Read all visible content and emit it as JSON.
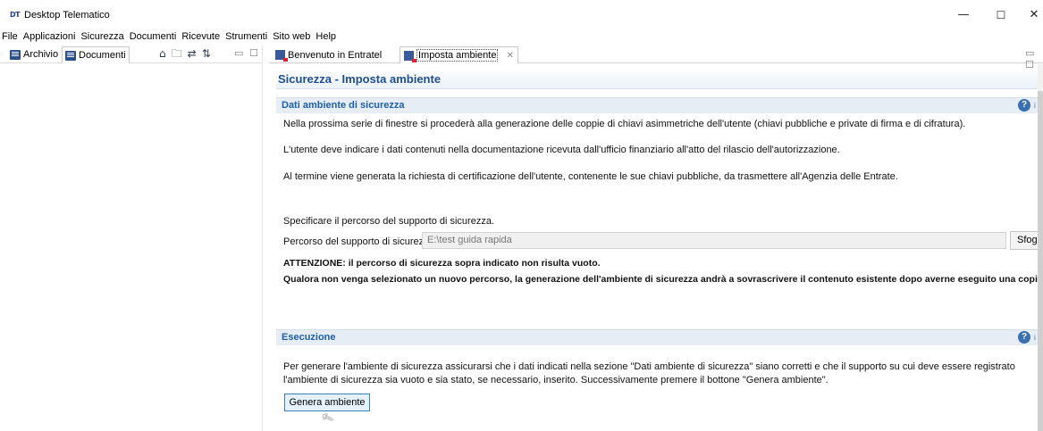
{
  "window": {
    "logo_text": "DT",
    "title": "Desktop Telematico",
    "min_glyph": "—",
    "max_glyph": "☐",
    "close_glyph": "✕"
  },
  "menu": {
    "items": [
      "File",
      "Applicazioni",
      "Sicurezza",
      "Documenti",
      "Ricevute",
      "Strumenti",
      "Sito web",
      "Help"
    ]
  },
  "left_pane": {
    "tabs": [
      {
        "label": "Archivio",
        "icon": "archive-icon"
      },
      {
        "label": "Documenti",
        "icon": "documents-icon"
      }
    ],
    "tools": [
      {
        "name": "home-icon",
        "glyph": "⌂"
      },
      {
        "name": "folder-icon",
        "glyph": "🗀"
      },
      {
        "name": "sync-icon",
        "glyph": "⇄"
      },
      {
        "name": "sort-icon",
        "glyph": "⇅"
      }
    ],
    "minimize_glyph": "▭",
    "maximize_glyph": "☐"
  },
  "right_pane": {
    "tabs": [
      {
        "label": "Benvenuto in Entratel",
        "icon": "entratel-icon"
      },
      {
        "label": "Imposta ambiente",
        "icon": "entratel-icon",
        "active": true
      }
    ],
    "tab_close_glyph": "✕",
    "ctrl_glyph": "▭ ☐"
  },
  "form": {
    "title": "Sicurezza - Imposta ambiente",
    "section1": {
      "title": "Dati ambiente di sicurezza",
      "help_glyph": "?",
      "help_suffix": "i",
      "p1": "Nella  prossima serie di finestre  si procederà  alla generazione delle coppie di chiavi asimmetriche dell'utente (chiavi pubbliche e private di firma e di cifratura).",
      "p2": "L'utente deve indicare i dati contenuti nella documentazione ricevuta dall'ufficio finanziario all'atto del rilascio dell'autorizzazione.",
      "p3": "Al termine viene generata la richiesta di certificazione dell'utente, contenente le sue chiavi pubbliche, da trasmettere all'Agenzia delle Entrate.",
      "specify": "Specificare il percorso del supporto di sicurezza.",
      "path_label": "Percorso del supporto di sicurezza:",
      "path_value": "E:\\test guida rapida",
      "browse_label": "Sfogl",
      "warning1": "ATTENZIONE: il percorso di sicurezza sopra indicato non risulta vuoto.",
      "warning2": "Qualora non venga selezionato un nuovo percorso, la generazione dell'ambiente di sicurezza andrà a sovrascrivere il contenuto esistente dopo averne eseguito una copia."
    },
    "section2": {
      "title": "Esecuzione",
      "help_glyph": "?",
      "help_suffix": "i",
      "line1": "Per generare l'ambiente di sicurezza assicurarsi che i dati indicati nella sezione \"Dati ambiente di sicurezza\" siano corretti e che il supporto su cui deve essere registrato",
      "line2": "l'ambiente di sicurezza sia vuoto e sia stato, se necessario, inserito. Successivamente premere il bottone \"Genera ambiente\".",
      "button_label": "Genera ambiente"
    }
  },
  "cursor_glyph": "↖",
  "colors": {
    "accent": "#1d5fa8",
    "section_bg": "#e6edf5",
    "button_bg": "#e5f1fb",
    "button_border": "#3c7fb1"
  }
}
